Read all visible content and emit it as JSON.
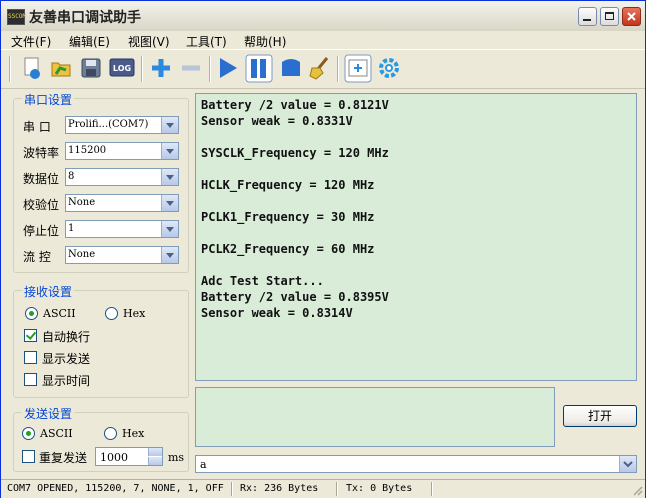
{
  "window": {
    "title": "友善串口调试助手",
    "app_icon_text": "SSCOM"
  },
  "menu": {
    "items": [
      "文件(F)",
      "编辑(E)",
      "视图(V)",
      "工具(T)",
      "帮助(H)"
    ]
  },
  "toolbar": {
    "log_label": "LOG"
  },
  "serial_settings": {
    "title": "串口设置",
    "rows": [
      {
        "label": "串  口",
        "value": "Prolifi...(COM7)"
      },
      {
        "label": "波特率",
        "value": "115200"
      },
      {
        "label": "数据位",
        "value": "8"
      },
      {
        "label": "校验位",
        "value": "None"
      },
      {
        "label": "停止位",
        "value": "1"
      },
      {
        "label": "流  控",
        "value": "None"
      }
    ]
  },
  "receive_settings": {
    "title": "接收设置",
    "ascii_label": "ASCII",
    "hex_label": "Hex",
    "mode": "ASCII",
    "options": [
      {
        "label": "自动换行",
        "checked": true
      },
      {
        "label": "显示发送",
        "checked": false
      },
      {
        "label": "显示时间",
        "checked": false
      }
    ]
  },
  "send_settings": {
    "title": "发送设置",
    "ascii_label": "ASCII",
    "hex_label": "Hex",
    "mode": "ASCII",
    "repeat_label": "重复发送",
    "repeat_checked": false,
    "interval": "1000",
    "unit": "ms"
  },
  "receive_area": {
    "lines": [
      "Battery /2 value = 0.8121V",
      "Sensor weak = 0.8331V",
      "",
      "SYSCLK_Frequency = 120 MHz",
      "",
      "HCLK_Frequency = 120 MHz",
      "",
      "PCLK1_Frequency = 30 MHz",
      "",
      "PCLK2_Frequency = 60 MHz",
      "",
      "Adc Test Start...",
      "Battery /2 value = 0.8395V",
      "Sensor weak = 0.8314V"
    ]
  },
  "open_button": "打开",
  "send_input": {
    "value": "a"
  },
  "status": {
    "port": "COM7 OPENED, 115200, 7, NONE, 1, OFF",
    "rx": "Rx: 236 Bytes",
    "tx": "Tx: 0 Bytes"
  },
  "colors": {
    "accent": "#0046d5",
    "text_area_bg": "#d8ecd8",
    "frame": "#0831d9"
  }
}
